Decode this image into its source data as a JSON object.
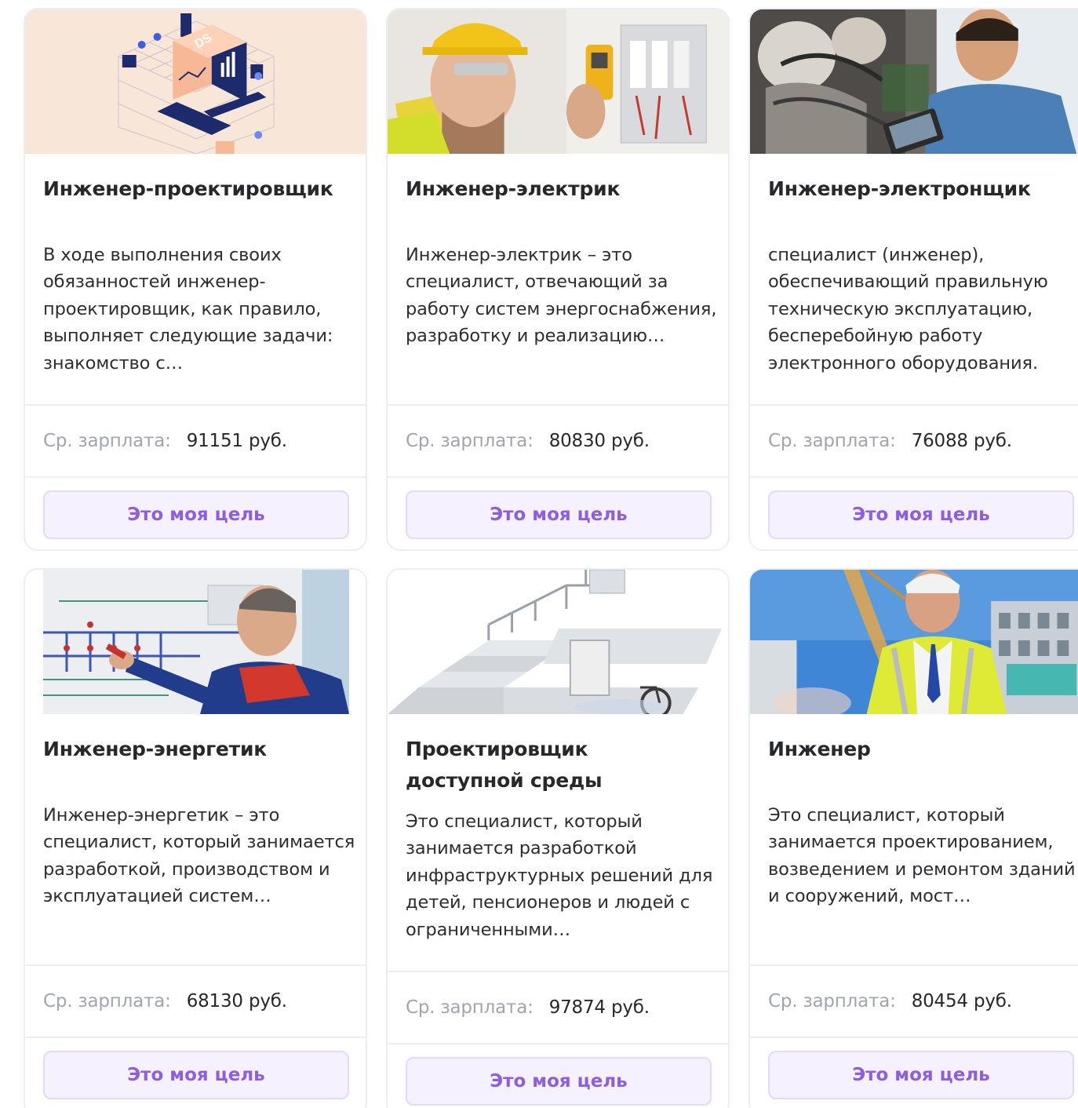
{
  "cards": [
    {
      "title": "Инженер-проектировщик",
      "description": "В ходе выполнения своих обязанностей инженер-проектировщик, как правило, выполняет следующие задачи: знакомство с…",
      "salary_label": "Ср. зарплата:",
      "salary_value": "91151 руб.",
      "button_label": "Это моя цель",
      "image_badge": "DS"
    },
    {
      "title": "Инженер-электрик",
      "description": "Инженер-электрик – это специалист, отвечающий за работу систем энергоснабжения, разработку и реализацию…",
      "salary_label": "Ср. зарплата:",
      "salary_value": "80830 руб.",
      "button_label": "Это моя цель"
    },
    {
      "title": "Инженер-электронщик",
      "description": "специалист (инженер), обеспечивающий правильную техническую эксплуатацию, бесперебойную работу электронного оборудования.",
      "salary_label": "Ср. зарплата:",
      "salary_value": "76088 руб.",
      "button_label": "Это моя цель"
    },
    {
      "title": "Инженер-энергетик",
      "description": "Инженер-энергетик – это специалист, который занимается разработкой, производством и эксплуатацией систем…",
      "salary_label": "Ср. зарплата:",
      "salary_value": "68130 руб.",
      "button_label": "Это моя цель"
    },
    {
      "title": "Проектировщик доступной среды",
      "description": "Это специалист, который занимается разработкой инфраструктурных решений для детей, пенсионеров и людей с ограниченными…",
      "salary_label": "Ср. зарплата:",
      "salary_value": "97874 руб.",
      "button_label": "Это моя цель"
    },
    {
      "title": "Инженер",
      "description": "Это специалист, который занимается проектированием, возведением и ремонтом зданий и сооружений, мост…",
      "salary_label": "Ср. зарплата:",
      "salary_value": "80454 руб.",
      "button_label": "Это моя цель"
    }
  ],
  "colors": {
    "accent": "#8d5ee0",
    "button_bg": "#f6f1fe",
    "muted_label": "#a0a3b2",
    "card_border": "#eceef3"
  }
}
